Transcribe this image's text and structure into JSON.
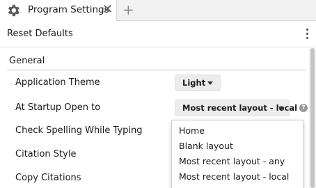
{
  "tab": {
    "icon": "gear-icon",
    "title": "Program Settings",
    "close": "✕",
    "add": "+"
  },
  "toolbar": {
    "reset_label": "Reset Defaults",
    "menu_icon": "more-vertical-icon"
  },
  "section": {
    "title": "General"
  },
  "settings": {
    "theme": {
      "label": "Application Theme",
      "value": "Light"
    },
    "startup": {
      "label": "At Startup Open to",
      "value": "Most recent layout - local",
      "help": "?"
    },
    "spelling": {
      "label": "Check Spelling While Typing"
    },
    "citation_style": {
      "label": "Citation Style"
    },
    "copy_citations": {
      "label": "Copy Citations"
    }
  },
  "dropdown": {
    "options": [
      "Home",
      "Blank layout",
      "Most recent layout - any",
      "Most recent layout - local"
    ]
  },
  "colors": {
    "tab_bar": "#f2f2f2",
    "select_bg": "#ececec",
    "scroll_thumb": "#c4c4c4"
  }
}
